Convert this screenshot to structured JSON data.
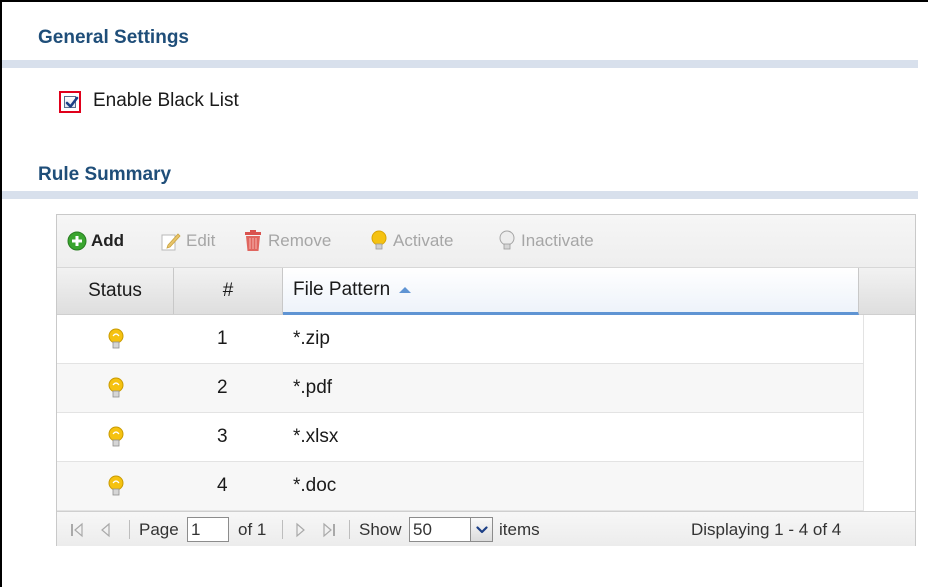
{
  "general_settings": {
    "title": "General Settings",
    "enable_black_list": {
      "label": "Enable Black List",
      "checked": true
    }
  },
  "rule_summary": {
    "title": "Rule Summary",
    "toolbar": {
      "add": "Add",
      "edit": "Edit",
      "remove": "Remove",
      "activate": "Activate",
      "inactivate": "Inactivate"
    },
    "columns": {
      "status": "Status",
      "index": "#",
      "file_pattern": "File Pattern"
    },
    "sort": {
      "column": "File Pattern",
      "direction": "ascending"
    },
    "rows": [
      {
        "status_icon": "bulb-active-icon",
        "index": "1",
        "pattern": "*.zip"
      },
      {
        "status_icon": "bulb-active-icon",
        "index": "2",
        "pattern": "*.pdf"
      },
      {
        "status_icon": "bulb-active-icon",
        "index": "3",
        "pattern": "*.xlsx"
      },
      {
        "status_icon": "bulb-active-icon",
        "index": "4",
        "pattern": "*.doc"
      }
    ],
    "pager": {
      "page_label": "Page",
      "page_value": "1",
      "of_label": "of 1",
      "show_label": "Show",
      "page_size": "50",
      "items_label": "items",
      "displaying": "Displaying 1 - 4 of 4"
    }
  },
  "colors": {
    "section_title": "#1f4e79",
    "section_rule": "#d8e0ec",
    "checkbox_highlight": "#e0001b",
    "add_green": "#3aa52f",
    "sort_accent": "#5f94d3",
    "bulb_yellow": "#f5c211"
  }
}
